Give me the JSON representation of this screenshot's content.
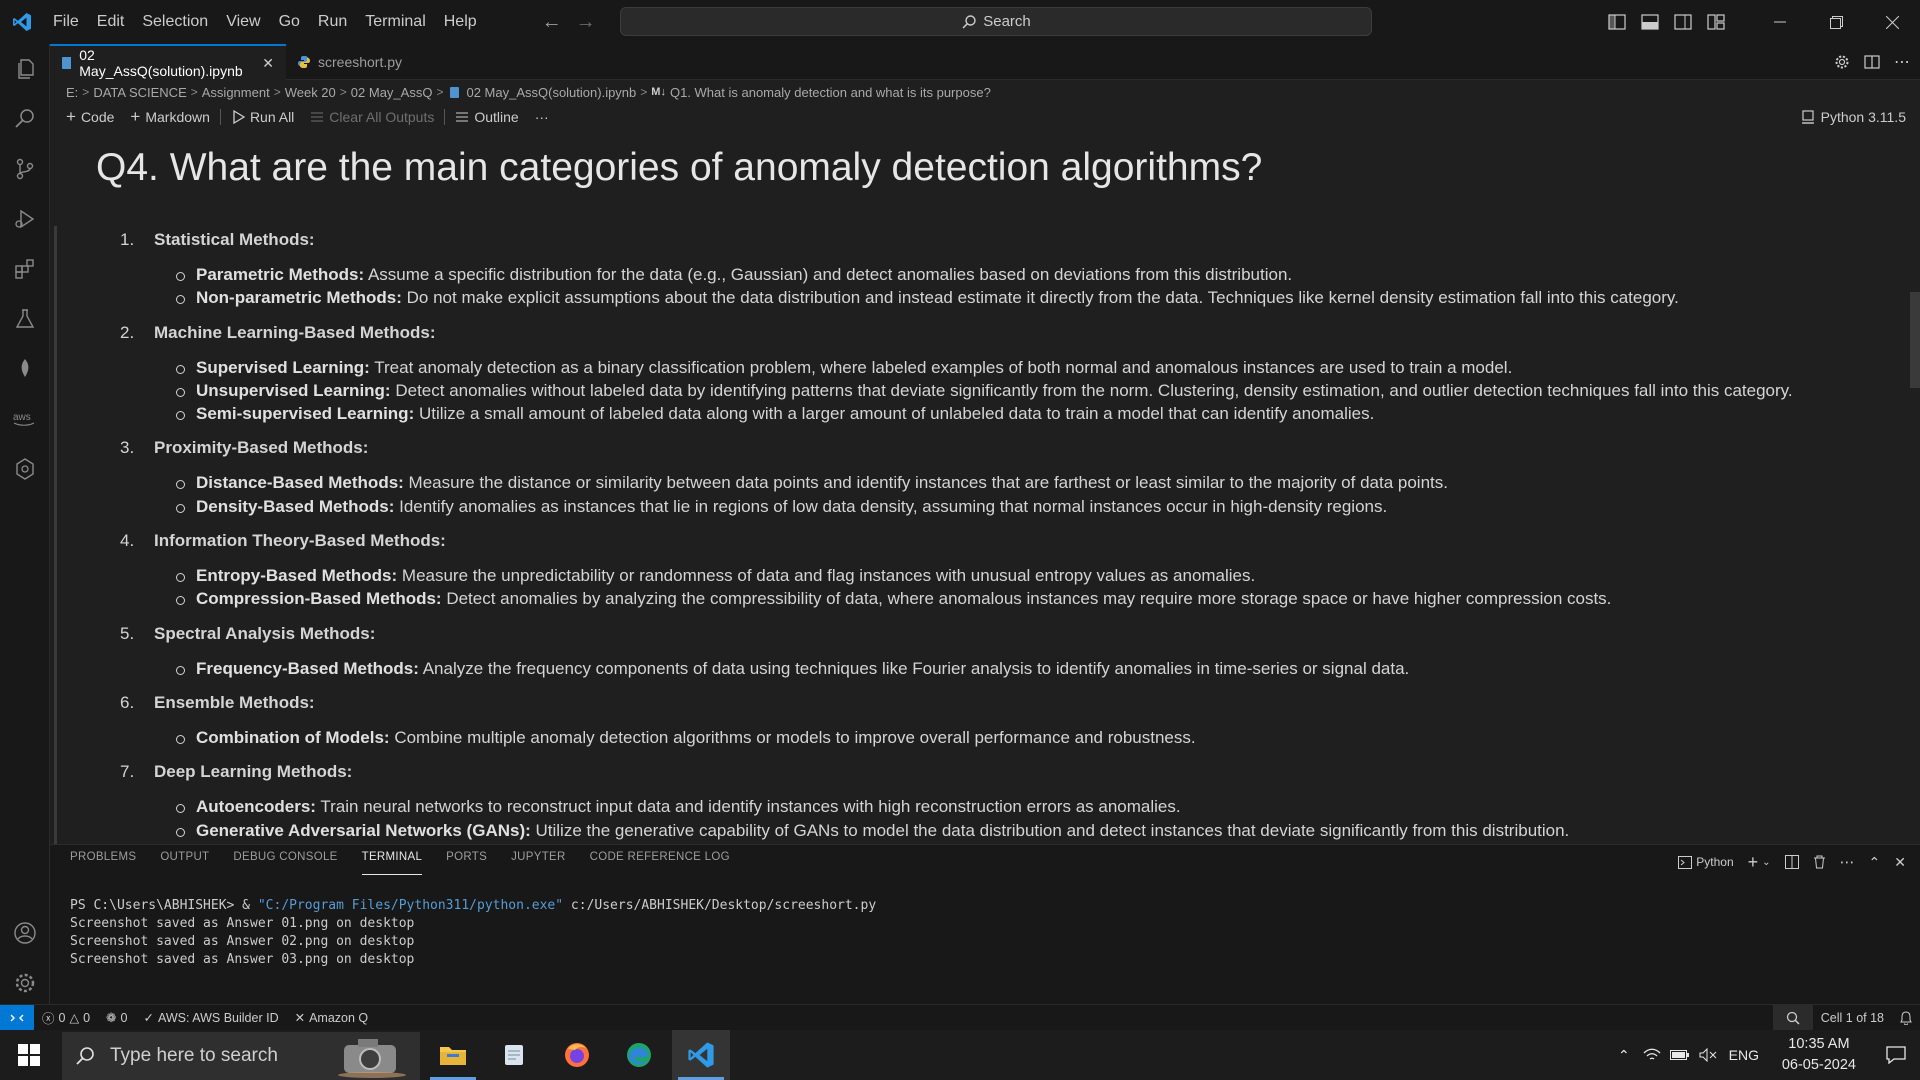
{
  "titlebar": {
    "menu": [
      "File",
      "Edit",
      "Selection",
      "View",
      "Go",
      "Run",
      "Terminal",
      "Help"
    ],
    "search_label": "Search"
  },
  "tabs": [
    {
      "label": "02 May_AssQ(solution).ipynb",
      "active": true
    },
    {
      "label": "screeshort.py",
      "active": false
    }
  ],
  "breadcrumb": [
    "E:",
    "DATA SCIENCE",
    "Assignment",
    "Week 20",
    "02 May_AssQ",
    "02 May_AssQ(solution).ipynb",
    "Q1. What is anomaly detection and what is its purpose?"
  ],
  "breadcrumb_md_badge": "M↓",
  "toolbar": {
    "code": "Code",
    "markdown": "Markdown",
    "run_all": "Run All",
    "clear_outputs": "Clear All Outputs",
    "outline": "Outline",
    "more": "···",
    "kernel": "Python 3.11.5"
  },
  "notebook": {
    "heading": "Q4. What are the main categories of anomaly detection algorithms?",
    "categories": [
      {
        "num": "1.",
        "title": "Statistical Methods:",
        "items": [
          {
            "term": "Parametric Methods:",
            "text": " Assume a specific distribution for the data (e.g., Gaussian) and detect anomalies based on deviations from this distribution."
          },
          {
            "term": "Non-parametric Methods:",
            "text": " Do not make explicit assumptions about the data distribution and instead estimate it directly from the data. Techniques like kernel density estimation fall into this category."
          }
        ]
      },
      {
        "num": "2.",
        "title": "Machine Learning-Based Methods:",
        "items": [
          {
            "term": "Supervised Learning:",
            "text": " Treat anomaly detection as a binary classification problem, where labeled examples of both normal and anomalous instances are used to train a model."
          },
          {
            "term": "Unsupervised Learning:",
            "text": " Detect anomalies without labeled data by identifying patterns that deviate significantly from the norm. Clustering, density estimation, and outlier detection techniques fall into this category."
          },
          {
            "term": "Semi-supervised Learning:",
            "text": " Utilize a small amount of labeled data along with a larger amount of unlabeled data to train a model that can identify anomalies."
          }
        ]
      },
      {
        "num": "3.",
        "title": "Proximity-Based Methods:",
        "items": [
          {
            "term": "Distance-Based Methods:",
            "text": " Measure the distance or similarity between data points and identify instances that are farthest or least similar to the majority of data points."
          },
          {
            "term": "Density-Based Methods:",
            "text": " Identify anomalies as instances that lie in regions of low data density, assuming that normal instances occur in high-density regions."
          }
        ]
      },
      {
        "num": "4.",
        "title": "Information Theory-Based Methods:",
        "items": [
          {
            "term": "Entropy-Based Methods:",
            "text": " Measure the unpredictability or randomness of data and flag instances with unusual entropy values as anomalies."
          },
          {
            "term": "Compression-Based Methods:",
            "text": " Detect anomalies by analyzing the compressibility of data, where anomalous instances may require more storage space or have higher compression costs."
          }
        ]
      },
      {
        "num": "5.",
        "title": "Spectral Analysis Methods:",
        "items": [
          {
            "term": "Frequency-Based Methods:",
            "text": " Analyze the frequency components of data using techniques like Fourier analysis to identify anomalies in time-series or signal data."
          }
        ]
      },
      {
        "num": "6.",
        "title": "Ensemble Methods:",
        "items": [
          {
            "term": "Combination of Models:",
            "text": " Combine multiple anomaly detection algorithms or models to improve overall performance and robustness."
          }
        ]
      },
      {
        "num": "7.",
        "title": "Deep Learning Methods:",
        "items": [
          {
            "term": "Autoencoders:",
            "text": " Train neural networks to reconstruct input data and identify instances with high reconstruction errors as anomalies."
          },
          {
            "term": "Generative Adversarial Networks (GANs):",
            "text": " Utilize the generative capability of GANs to model the data distribution and detect instances that deviate significantly from this distribution."
          }
        ]
      }
    ]
  },
  "panel": {
    "tabs": [
      "PROBLEMS",
      "OUTPUT",
      "DEBUG CONSOLE",
      "TERMINAL",
      "PORTS",
      "JUPYTER",
      "CODE REFERENCE LOG"
    ],
    "active_tab": "TERMINAL",
    "shell_label": "Python",
    "terminal": {
      "prompt": "PS C:\\Users\\ABHISHEK> & ",
      "exe": "\"C:/Program Files/Python311/python.exe\"",
      "script": " c:/Users/ABHISHEK/Desktop/screeshort.py",
      "output": [
        "Screenshot saved as Answer 01.png on desktop",
        "Screenshot saved as Answer 02.png on desktop",
        "Screenshot saved as Answer 03.png on desktop"
      ]
    }
  },
  "statusbar": {
    "errors": "0",
    "warnings": "0",
    "ports": "0",
    "aws": "AWS: AWS Builder ID",
    "amazon_q": "Amazon Q",
    "cell": "Cell 1 of 18"
  },
  "taskbar": {
    "search_placeholder": "Type here to search",
    "language": "ENG",
    "time": "10:35 AM",
    "date": "06-05-2024"
  },
  "colors": {
    "accent": "#0078d4",
    "editor_bg": "#1f1f1f",
    "chrome_bg": "#181818",
    "terminal_string": "#569cd6"
  }
}
